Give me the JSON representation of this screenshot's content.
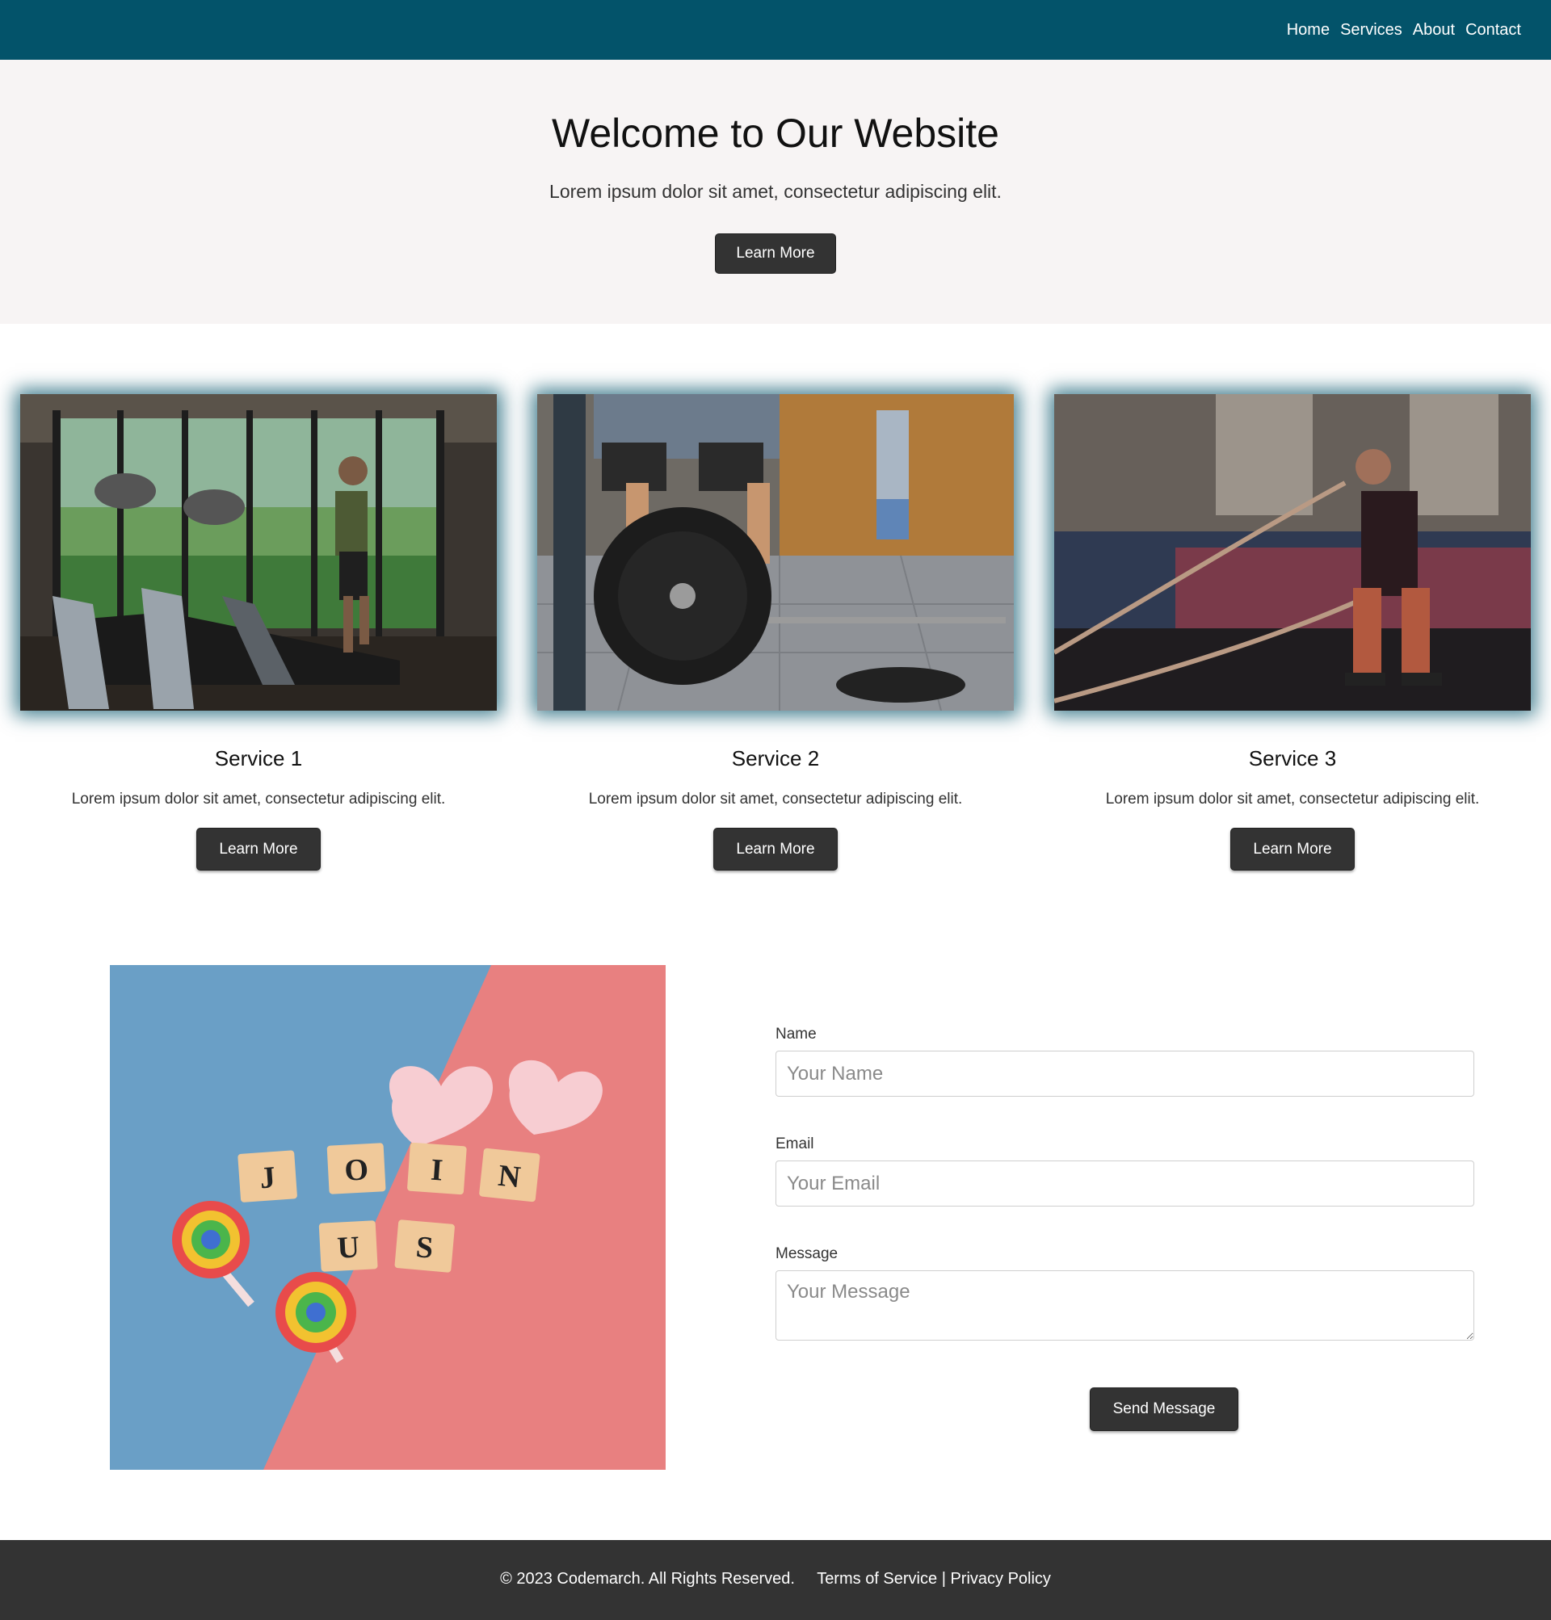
{
  "nav": {
    "links": [
      "Home",
      "Services",
      "About",
      "Contact"
    ]
  },
  "hero": {
    "title": "Welcome to Our Website",
    "subtitle": "Lorem ipsum dolor sit amet, consectetur adipiscing elit.",
    "button_label": "Learn More"
  },
  "services": [
    {
      "title": "Service 1",
      "text": "Lorem ipsum dolor sit amet, consectetur adipiscing elit.",
      "button_label": "Learn More",
      "image": "treadmill-gym-photo"
    },
    {
      "title": "Service 2",
      "text": "Lorem ipsum dolor sit amet, consectetur adipiscing elit.",
      "button_label": "Learn More",
      "image": "weight-plate-photo"
    },
    {
      "title": "Service 3",
      "text": "Lorem ipsum dolor sit amet, consectetur adipiscing elit.",
      "button_label": "Learn More",
      "image": "battle-ropes-photo"
    }
  ],
  "join_image": {
    "tiles_row1": [
      "J",
      "O",
      "I",
      "N"
    ],
    "tiles_row2": [
      "U",
      "S"
    ]
  },
  "form": {
    "name_label": "Name",
    "name_placeholder": "Your Name",
    "email_label": "Email",
    "email_placeholder": "Your Email",
    "message_label": "Message",
    "message_placeholder": "Your Message",
    "submit_label": "Send Message"
  },
  "footer": {
    "copyright": "© 2023 Codemarch. All Rights Reserved.",
    "terms": "Terms of Service",
    "separator": "|",
    "privacy": "Privacy Policy"
  },
  "colors": {
    "nav_bg": "#03536a",
    "hero_bg": "#f7f4f4",
    "button_bg": "#333333",
    "footer_bg": "#333333"
  }
}
